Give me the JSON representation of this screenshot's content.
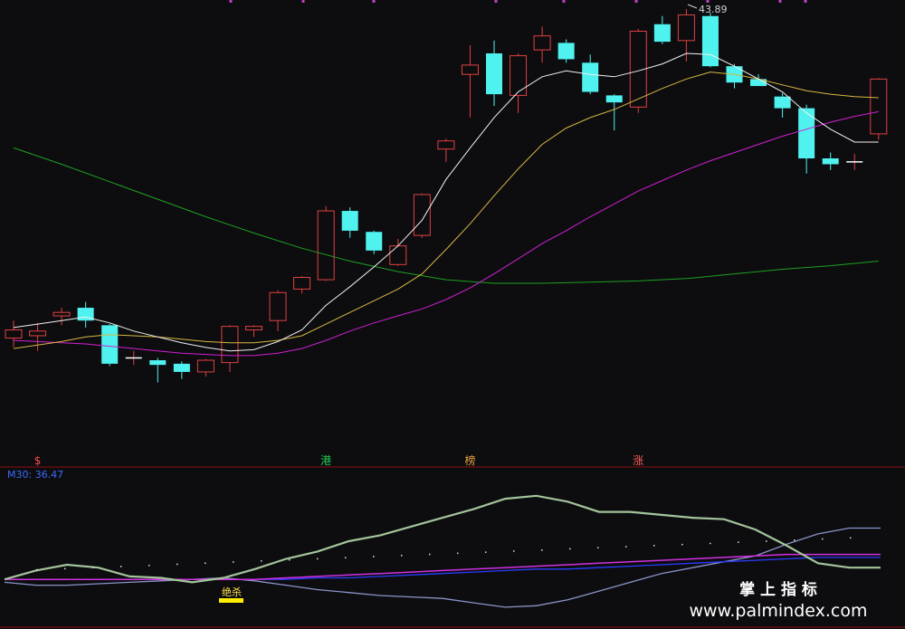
{
  "chart_data": {
    "type": "candlestick",
    "price_panel": {
      "ylim": [
        10.7,
        43.9
      ],
      "high_label": "43.89",
      "candles": [
        {
          "o": 15.7,
          "h": 17.2,
          "l": 14.9,
          "c": 16.4
        },
        {
          "o": 15.9,
          "h": 17.0,
          "l": 14.6,
          "c": 16.3
        },
        {
          "o": 17.6,
          "h": 18.3,
          "l": 16.8,
          "c": 17.9
        },
        {
          "o": 18.3,
          "h": 18.8,
          "l": 16.6,
          "c": 17.2
        },
        {
          "o": 16.8,
          "h": 16.9,
          "l": 13.3,
          "c": 13.5
        },
        {
          "o": 14.0,
          "h": 14.6,
          "l": 13.4,
          "c": 14.0
        },
        {
          "o": 13.8,
          "h": 14.0,
          "l": 11.9,
          "c": 13.4
        },
        {
          "o": 13.5,
          "h": 13.7,
          "l": 12.2,
          "c": 12.8
        },
        {
          "o": 12.8,
          "h": 13.9,
          "l": 12.4,
          "c": 13.8
        },
        {
          "o": 13.6,
          "h": 16.8,
          "l": 12.8,
          "c": 16.7
        },
        {
          "o": 16.4,
          "h": 16.8,
          "l": 15.8,
          "c": 16.7
        },
        {
          "o": 17.2,
          "h": 19.8,
          "l": 16.3,
          "c": 19.6
        },
        {
          "o": 19.9,
          "h": 21.0,
          "l": 19.5,
          "c": 20.9
        },
        {
          "o": 20.7,
          "h": 27.0,
          "l": 20.6,
          "c": 26.6
        },
        {
          "o": 26.6,
          "h": 26.9,
          "l": 24.3,
          "c": 24.9
        },
        {
          "o": 24.8,
          "h": 24.9,
          "l": 22.9,
          "c": 23.2
        },
        {
          "o": 22.0,
          "h": 24.2,
          "l": 21.9,
          "c": 23.6
        },
        {
          "o": 24.5,
          "h": 28.1,
          "l": 24.3,
          "c": 28.0
        },
        {
          "o": 31.9,
          "h": 32.8,
          "l": 30.8,
          "c": 32.6
        },
        {
          "o": 38.3,
          "h": 40.8,
          "l": 34.6,
          "c": 39.1
        },
        {
          "o": 40.1,
          "h": 41.2,
          "l": 35.6,
          "c": 36.6
        },
        {
          "o": 36.5,
          "h": 40.1,
          "l": 35.0,
          "c": 39.9
        },
        {
          "o": 40.4,
          "h": 42.4,
          "l": 39.3,
          "c": 41.6
        },
        {
          "o": 41.0,
          "h": 41.3,
          "l": 39.3,
          "c": 39.6
        },
        {
          "o": 39.3,
          "h": 40.0,
          "l": 36.6,
          "c": 36.8
        },
        {
          "o": 36.5,
          "h": 36.6,
          "l": 33.5,
          "c": 35.9
        },
        {
          "o": 35.5,
          "h": 42.2,
          "l": 35.0,
          "c": 42.0
        },
        {
          "o": 42.6,
          "h": 43.3,
          "l": 40.9,
          "c": 41.1
        },
        {
          "o": 41.2,
          "h": 43.9,
          "l": 39.4,
          "c": 43.4
        },
        {
          "o": 43.3,
          "h": 43.6,
          "l": 38.9,
          "c": 39.0
        },
        {
          "o": 39.0,
          "h": 39.2,
          "l": 37.1,
          "c": 37.6
        },
        {
          "o": 37.9,
          "h": 38.3,
          "l": 37.3,
          "c": 37.3
        },
        {
          "o": 36.4,
          "h": 36.7,
          "l": 34.6,
          "c": 35.4
        },
        {
          "o": 35.4,
          "h": 35.7,
          "l": 29.8,
          "c": 31.1
        },
        {
          "o": 31.1,
          "h": 31.6,
          "l": 30.1,
          "c": 30.6
        },
        {
          "o": 30.8,
          "h": 31.5,
          "l": 30.1,
          "c": 30.8
        },
        {
          "o": 33.2,
          "h": 38.0,
          "l": 32.7,
          "c": 37.9
        }
      ],
      "ma_white": [
        16.6,
        16.9,
        17.2,
        17.5,
        17.0,
        16.3,
        15.8,
        15.3,
        14.9,
        14.6,
        14.7,
        15.4,
        16.4,
        18.5,
        20.1,
        21.8,
        23.6,
        25.8,
        29.3,
        32.0,
        34.6,
        36.8,
        38.1,
        38.6,
        38.3,
        38.1,
        38.6,
        39.2,
        40.1,
        40.0,
        39.0,
        37.9,
        36.8,
        35.0,
        33.6,
        32.5,
        32.5
      ],
      "ma_yellow": [
        14.8,
        15.1,
        15.4,
        15.8,
        16.0,
        15.9,
        15.8,
        15.6,
        15.4,
        15.3,
        15.3,
        15.5,
        15.9,
        16.9,
        17.9,
        18.9,
        19.9,
        21.2,
        23.3,
        25.5,
        27.9,
        30.2,
        32.3,
        33.7,
        34.6,
        35.3,
        36.2,
        37.1,
        37.9,
        38.5,
        38.3,
        37.9,
        37.4,
        36.9,
        36.6,
        36.4,
        36.3
      ],
      "ma_magenta": [
        15.5,
        15.4,
        15.3,
        15.2,
        15.0,
        14.8,
        14.6,
        14.4,
        14.3,
        14.2,
        14.2,
        14.4,
        14.8,
        15.5,
        16.3,
        17.0,
        17.6,
        18.2,
        19.0,
        20.0,
        21.2,
        22.5,
        23.8,
        24.9,
        26.1,
        27.2,
        28.3,
        29.2,
        30.1,
        30.9,
        31.6,
        32.3,
        33.0,
        33.6,
        34.2,
        34.7,
        35.1
      ],
      "ma_green_x": [
        0,
        2,
        4,
        6,
        8,
        10,
        12,
        14,
        16,
        18,
        20,
        22,
        24,
        26,
        28,
        30,
        32,
        34,
        36
      ],
      "ma_green": [
        32.0,
        30.6,
        29.1,
        27.6,
        26.1,
        24.7,
        23.4,
        22.3,
        21.4,
        20.7,
        20.4,
        20.4,
        20.5,
        20.6,
        20.8,
        21.2,
        21.6,
        21.9,
        22.3
      ]
    },
    "signal_labels": [
      {
        "index": 1,
        "text": "$"
      },
      {
        "index": 13,
        "text": "港"
      },
      {
        "index": 19,
        "text": "榜"
      },
      {
        "index": 26,
        "text": "涨"
      }
    ],
    "indicator_panel": {
      "legend": "M30: 36.47",
      "ylim": [
        0,
        100
      ],
      "x": [
        0,
        4,
        8,
        12,
        16,
        20,
        24,
        28,
        32,
        36
      ],
      "line_sage": [
        32,
        38,
        42,
        40,
        34,
        33,
        30,
        33,
        39,
        46,
        51,
        58,
        62,
        68,
        74,
        80,
        87,
        89,
        85,
        78,
        78,
        76,
        74,
        73,
        66,
        55,
        43,
        40,
        40
      ],
      "line_steel": [
        30,
        28,
        28,
        29,
        30,
        31,
        32,
        33,
        31,
        28,
        25,
        23,
        21,
        20,
        19,
        16,
        13,
        14,
        18,
        24,
        30,
        36,
        40,
        44,
        48,
        56,
        63,
        67,
        67
      ],
      "line_magenta": [
        32,
        32,
        32,
        32,
        32,
        32,
        32,
        32,
        32,
        33,
        34,
        35,
        36,
        37,
        38,
        39,
        40,
        41,
        42,
        43,
        44,
        45,
        46,
        47,
        48,
        49,
        49,
        49,
        49
      ],
      "line_blue": [
        32,
        32,
        32,
        32,
        32,
        32,
        32,
        32,
        32,
        32,
        33,
        33,
        34,
        35,
        36,
        37,
        38,
        39,
        39,
        40,
        41,
        42,
        43,
        44,
        45,
        46,
        47,
        47,
        47
      ],
      "signal_text": "绝杀"
    }
  },
  "watermark": {
    "title": "掌 上 指 标",
    "url": "www.palmindex.com"
  },
  "colors": {
    "background": "#0d0d10",
    "up": "#e04040",
    "down": "#4ff2ee",
    "divider": "#8a1010"
  }
}
